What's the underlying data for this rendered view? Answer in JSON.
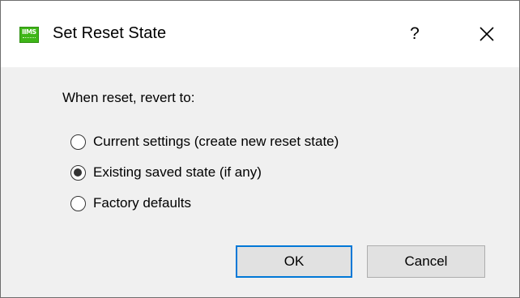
{
  "window": {
    "title": "Set Reset State",
    "icon": "app-logo-icon",
    "icon_color": "#3fb618",
    "help_label": "?",
    "close_icon": "close-icon"
  },
  "content": {
    "prompt": "When reset, revert to:",
    "options": [
      {
        "label": "Current settings (create new reset state)",
        "checked": false
      },
      {
        "label": "Existing saved state (if any)",
        "checked": true
      },
      {
        "label": "Factory defaults",
        "checked": false
      }
    ]
  },
  "buttons": {
    "ok_label": "OK",
    "cancel_label": "Cancel",
    "default_border_color": "#0078d7"
  }
}
